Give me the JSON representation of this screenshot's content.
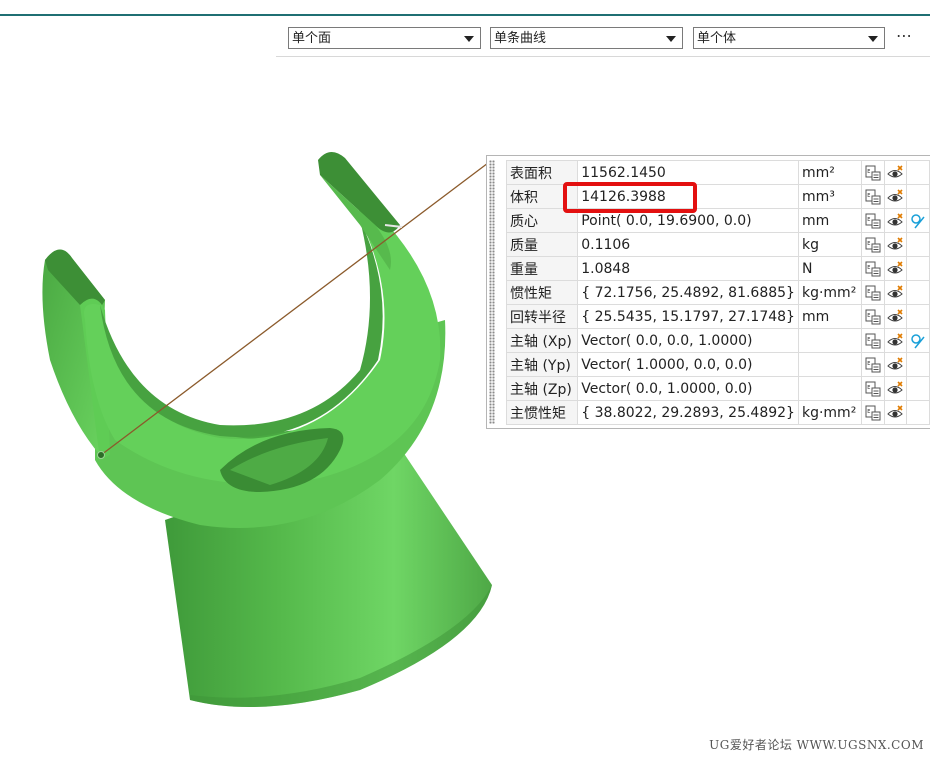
{
  "toolbar": {
    "face_filter": "单个面",
    "curve_filter": "单条曲线",
    "body_filter": "单个体",
    "more_label": "⋯"
  },
  "properties": [
    {
      "name": "表面积",
      "value": "11562.1450",
      "unit": "mm²",
      "has_vector": false
    },
    {
      "name": "体积",
      "value": "14126.3988",
      "unit": "mm³",
      "has_vector": false
    },
    {
      "name": "质心",
      "value": "Point( 0.0, 19.6900, 0.0)",
      "unit": "mm",
      "has_vector": true
    },
    {
      "name": "质量",
      "value": "0.1106",
      "unit": "kg",
      "has_vector": false
    },
    {
      "name": "重量",
      "value": "1.0848",
      "unit": "N",
      "has_vector": false
    },
    {
      "name": "惯性矩",
      "value": "{ 72.1756, 25.4892, 81.6885}",
      "unit": "kg·mm²",
      "has_vector": false
    },
    {
      "name": "回转半径",
      "value": "{ 25.5435, 15.1797, 27.1748}",
      "unit": "mm",
      "has_vector": false
    },
    {
      "name": "主轴 (Xp)",
      "value": "Vector( 0.0, 0.0, 1.0000)",
      "unit": "",
      "has_vector": true
    },
    {
      "name": "主轴 (Yp)",
      "value": "Vector( 1.0000, 0.0, 0.0)",
      "unit": "",
      "has_vector": false
    },
    {
      "name": "主轴 (Zp)",
      "value": "Vector( 0.0, 1.0000, 0.0)",
      "unit": "",
      "has_vector": false
    },
    {
      "name": "主惯性矩",
      "value": "{ 38.8022, 29.2893, 25.4892}",
      "unit": "kg·mm²",
      "has_vector": false
    }
  ],
  "icons": [
    "export-table-icon",
    "show-hide-icon",
    "vector-display-icon"
  ],
  "colors": {
    "model_green": "#5cc452",
    "highlight": "#e31010",
    "leader_line": "#8b5a2b",
    "header_rule": "#1f6f73"
  },
  "watermark": "UG爱好者论坛 WWW.UGSNX.COM"
}
